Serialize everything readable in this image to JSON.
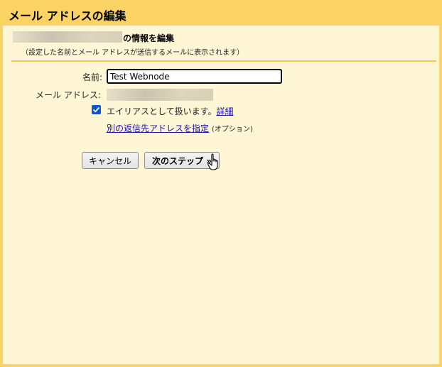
{
  "dialog": {
    "title": "メール アドレスの編集",
    "heading": "の情報を編集",
    "note": "（設定した名前とメール アドレスが送信するメールに表示されます）"
  },
  "form": {
    "name_label": "名前:",
    "name_value": "Test Webnode",
    "email_label": "メール アドレス:",
    "alias_checked": true,
    "alias_label": "エイリアスとして扱います。",
    "details_link": "詳細",
    "reply_link": "別の返信先アドレスを指定",
    "reply_option": "(オプション)"
  },
  "buttons": {
    "cancel": "キャンセル",
    "next": "次のステップ »"
  },
  "colors": {
    "title_bar": "#fbd264",
    "panel": "#fff6d5",
    "link": "#1a0dab",
    "checkbox": "#0b57d0"
  },
  "icons": {
    "cursor": "hand-pointer-icon",
    "check": "checkmark-icon"
  }
}
